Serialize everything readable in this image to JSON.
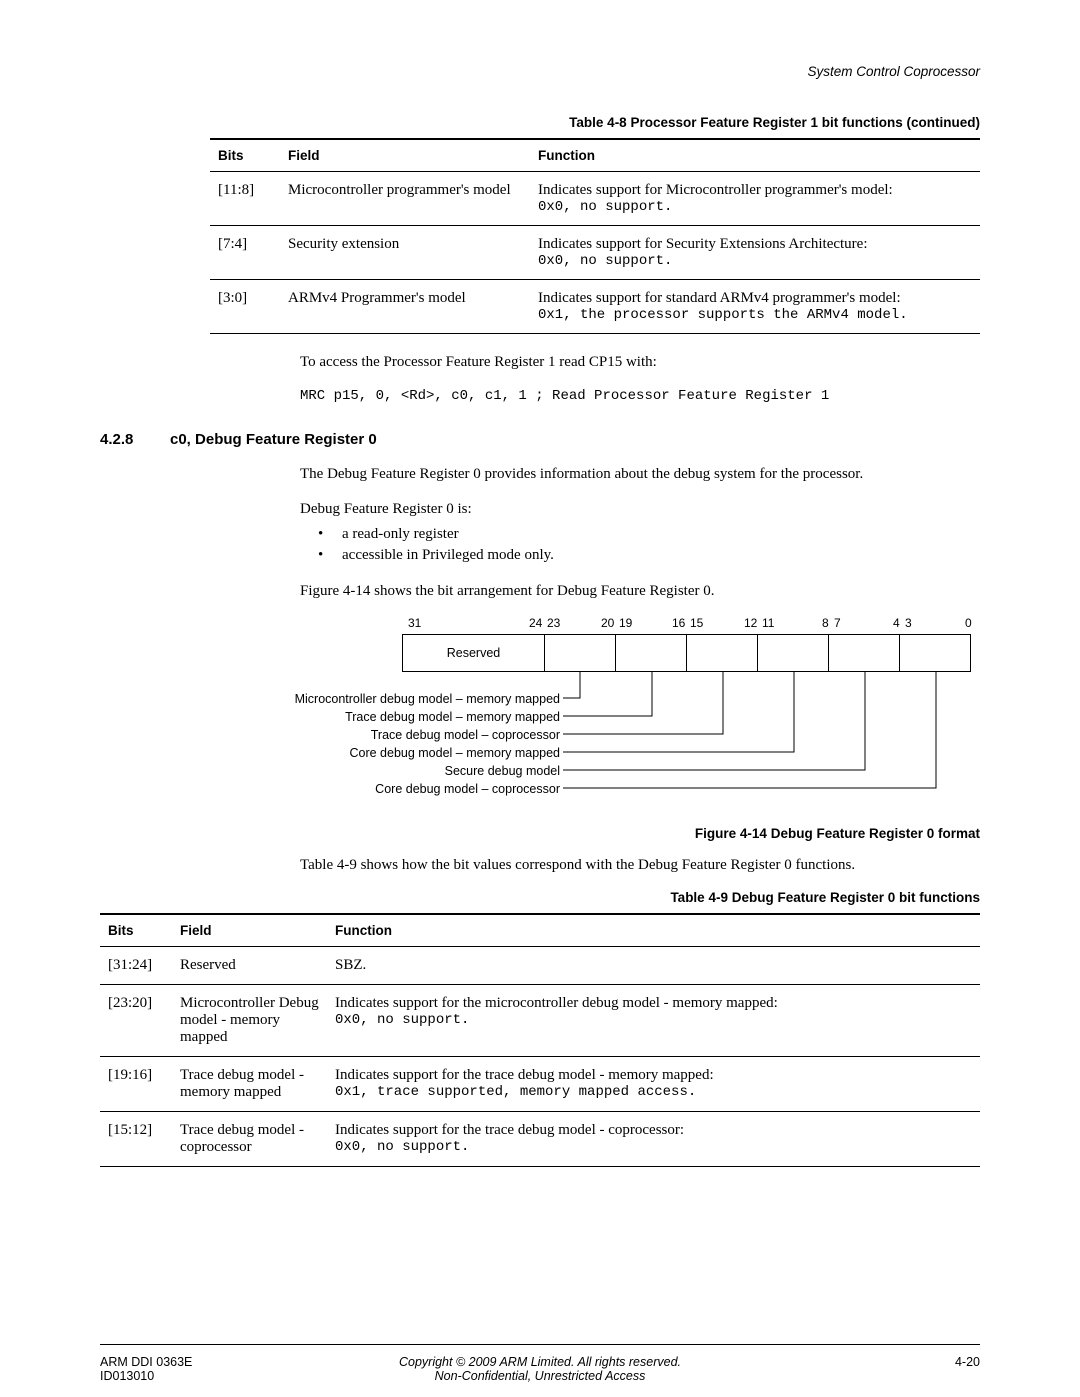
{
  "header": {
    "section_name": "System Control Coprocessor"
  },
  "table48": {
    "caption": "Table 4-8 Processor Feature Register 1 bit functions (continued)",
    "headers": {
      "c0": "Bits",
      "c1": "Field",
      "c2": "Function"
    },
    "rows": [
      {
        "bits": "[11:8]",
        "field": "Microcontroller programmer's model",
        "func_l1": "Indicates support for Microcontroller programmer's model:",
        "func_l2": "0x0, no support."
      },
      {
        "bits": "[7:4]",
        "field": "Security extension",
        "func_l1": "Indicates support for Security Extensions Architecture:",
        "func_l2": "0x0, no support."
      },
      {
        "bits": "[3:0]",
        "field": "ARMv4 Programmer's model",
        "func_l1": "Indicates support for standard ARMv4 programmer's model:",
        "func_l2": "0x1, the processor supports the ARMv4 model."
      }
    ]
  },
  "para1": "To access the Processor Feature Register 1 read CP15 with:",
  "code1": "MRC p15, 0, <Rd>, c0, c1, 1 ; Read Processor Feature Register 1",
  "section": {
    "num": "4.2.8",
    "title": "c0, Debug Feature Register 0"
  },
  "para2": "The Debug Feature Register 0 provides information about the debug system for the processor.",
  "para3": "Debug Feature Register 0 is:",
  "bullets": {
    "b0": "a read-only register",
    "b1": "accessible in Privileged mode only."
  },
  "para4": "Figure 4-14 shows the bit arrangement for Debug Feature Register 0.",
  "bitfig": {
    "nums": {
      "n31": "31",
      "n24": "24",
      "n23": "23",
      "n20": "20",
      "n19": "19",
      "n16": "16",
      "n15": "15",
      "n12": "12",
      "n11": "11",
      "n8": "8",
      "n7": "7",
      "n4": "4",
      "n3": "3",
      "n0": "0"
    },
    "reserved": "Reserved",
    "labels": {
      "l0": "Microcontroller debug model – memory mapped",
      "l1": "Trace debug model – memory mapped",
      "l2": "Trace debug model – coprocessor",
      "l3": "Core debug model – memory mapped",
      "l4": "Secure debug model",
      "l5": "Core debug model – coprocessor"
    }
  },
  "figcaption": "Figure 4-14 Debug Feature Register 0 format",
  "para5": "Table 4-9 shows how the bit values correspond with the Debug Feature Register 0 functions.",
  "table49": {
    "caption": "Table 4-9 Debug Feature Register 0 bit functions",
    "headers": {
      "c0": "Bits",
      "c1": "Field",
      "c2": "Function"
    },
    "rows": [
      {
        "bits": "[31:24]",
        "field": "Reserved",
        "func_l1": "SBZ.",
        "func_l2": ""
      },
      {
        "bits": "[23:20]",
        "field": "Microcontroller Debug model - memory mapped",
        "func_l1": "Indicates support for the microcontroller debug model - memory mapped:",
        "func_l2": "0x0, no support."
      },
      {
        "bits": "[19:16]",
        "field": "Trace debug model - memory mapped",
        "func_l1": "Indicates support for the trace debug model - memory mapped:",
        "func_l2": "0x1, trace supported, memory mapped access."
      },
      {
        "bits": "[15:12]",
        "field": "Trace debug model - coprocessor",
        "func_l1": "Indicates support for the trace debug model - coprocessor:",
        "func_l2": "0x0, no support."
      }
    ]
  },
  "footer": {
    "left_l1": "ARM DDI 0363E",
    "left_l2": "ID013010",
    "center_l1": "Copyright © 2009 ARM Limited. All rights reserved.",
    "center_l2": "Non-Confidential, Unrestricted Access",
    "right": "4-20"
  }
}
